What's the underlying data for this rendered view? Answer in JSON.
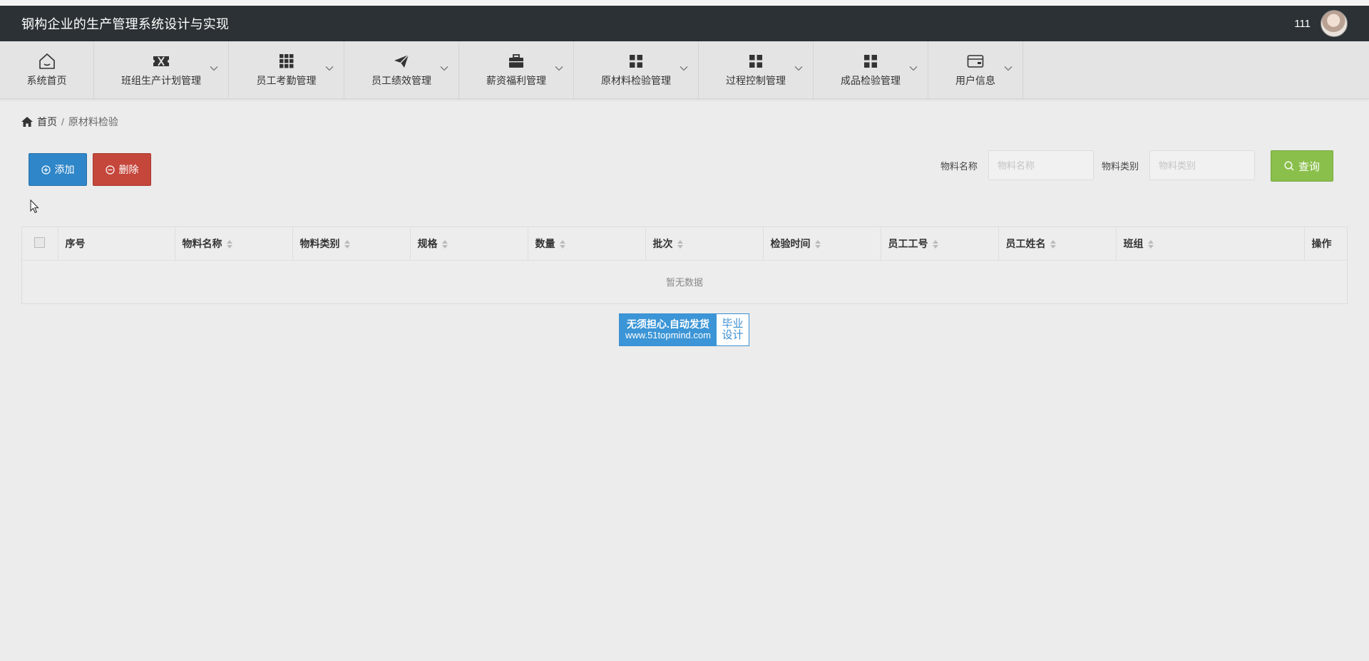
{
  "app": {
    "title": "钢构企业的生产管理系统设计与实现",
    "username": "111"
  },
  "nav": [
    {
      "label": "系统首页",
      "icon": "home-icon",
      "dropdown": false,
      "width": 132
    },
    {
      "label": "班组生产计划管理",
      "icon": "ticket-icon",
      "dropdown": true,
      "width": 189
    },
    {
      "label": "员工考勤管理",
      "icon": "grid-icon",
      "dropdown": true,
      "width": 162
    },
    {
      "label": "员工绩效管理",
      "icon": "paper-plane-icon",
      "dropdown": true,
      "width": 161
    },
    {
      "label": "薪资福利管理",
      "icon": "briefcase-icon",
      "dropdown": true,
      "width": 161
    },
    {
      "label": "原材料检验管理",
      "icon": "dashboard-icon",
      "dropdown": true,
      "width": 175
    },
    {
      "label": "过程控制管理",
      "icon": "dashboard-icon",
      "dropdown": true,
      "width": 161
    },
    {
      "label": "成品检验管理",
      "icon": "dashboard-icon",
      "dropdown": true,
      "width": 161
    },
    {
      "label": "用户信息",
      "icon": "card-icon",
      "dropdown": true,
      "width": 133
    }
  ],
  "breadcrumb": {
    "home": "首页",
    "separator": "/",
    "current": "原材料检验"
  },
  "toolbar": {
    "add_label": "添加",
    "delete_label": "删除"
  },
  "search": {
    "name_label": "物料名称",
    "name_placeholder": "物料名称",
    "category_label": "物料类别",
    "category_placeholder": "物料类别",
    "button_label": "查询"
  },
  "table": {
    "columns": [
      {
        "label": "序号",
        "sortable": false
      },
      {
        "label": "物料名称",
        "sortable": true
      },
      {
        "label": "物料类别",
        "sortable": true
      },
      {
        "label": "规格",
        "sortable": true
      },
      {
        "label": "数量",
        "sortable": true
      },
      {
        "label": "批次",
        "sortable": true
      },
      {
        "label": "检验时间",
        "sortable": true
      },
      {
        "label": "员工工号",
        "sortable": true
      },
      {
        "label": "员工姓名",
        "sortable": true
      },
      {
        "label": "班组",
        "sortable": true
      },
      {
        "label": "操作",
        "sortable": false
      }
    ],
    "empty_text": "暂无数据"
  },
  "watermark": {
    "line1": "无须担心.自动发货",
    "line2": "www.51topmind.com",
    "right_line1": "毕业",
    "right_line2": "设计"
  }
}
